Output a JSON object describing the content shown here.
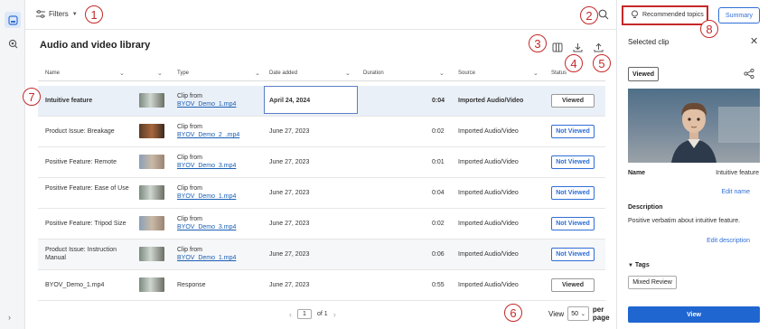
{
  "topbar": {
    "filters_label": "Filters"
  },
  "library": {
    "title": "Audio and video library"
  },
  "columns": [
    "Name",
    "Type",
    "Date added",
    "Duration",
    "Source",
    "Status"
  ],
  "rows": [
    {
      "name": "Intuitive feature",
      "type_line1": "Clip from",
      "type_file": "BYOV_Demo_1.mp4",
      "date": "April 24, 2024",
      "duration": "0:04",
      "source": "Imported Audio/Video",
      "status": "Viewed"
    },
    {
      "name": "Product Issue: Breakage",
      "type_line1": "Clip from",
      "type_file": "BYOV_Demo_2_.mp4",
      "date": "June 27, 2023",
      "duration": "0:02",
      "source": "Imported Audio/Video",
      "status": "Not Viewed"
    },
    {
      "name": "Positive Feature: Remote",
      "type_line1": "Clip from",
      "type_file": "BYOV_Demo_3.mp4",
      "date": "June 27, 2023",
      "duration": "0:01",
      "source": "Imported Audio/Video",
      "status": "Not Viewed"
    },
    {
      "name": "Positive Feature: Ease of Use",
      "type_line1": "Clip from",
      "type_file": "BYOV_Demo_1.mp4",
      "date": "June 27, 2023",
      "duration": "0:04",
      "source": "Imported Audio/Video",
      "status": "Not Viewed"
    },
    {
      "name": "Positive Feature: Tripod Size",
      "type_line1": "Clip from",
      "type_file": "BYOV_Demo_3.mp4",
      "date": "June 27, 2023",
      "duration": "0:02",
      "source": "Imported Audio/Video",
      "status": "Not Viewed"
    },
    {
      "name": "Product Issue: Instruction Manual",
      "type_line1": "Clip from",
      "type_file": "BYOV_Demo_1.mp4",
      "date": "June 27, 2023",
      "duration": "0:06",
      "source": "Imported Audio/Video",
      "status": "Not Viewed"
    },
    {
      "name": "BYOV_Demo_1.mp4",
      "type_line1": "Response",
      "type_file": "",
      "date": "June 27, 2023",
      "duration": "0:55",
      "source": "Imported Audio/Video",
      "status": "Viewed"
    }
  ],
  "pagination": {
    "page": "1",
    "of_label": "of 1",
    "view_label": "View",
    "per_page_value": "50",
    "per_page_label": "per page"
  },
  "panel": {
    "recommended_label": "Recommended topics",
    "summary_label": "Summary",
    "title": "Selected clip",
    "viewed_badge": "Viewed",
    "name_label": "Name",
    "name_value": "Intuitive feature",
    "edit_name": "Edit name",
    "description_label": "Description",
    "description_value": "Positive verbatim about intuitive feature.",
    "edit_description": "Edit description",
    "tags_label": "Tags",
    "tag": "Mixed Review",
    "view_button": "View"
  },
  "callouts": [
    "1",
    "2",
    "3",
    "4",
    "5",
    "6",
    "7",
    "8"
  ],
  "colors": {
    "accent": "#2f6fd6",
    "callout": "#c62828",
    "selected_row": "#eaf0f8"
  }
}
